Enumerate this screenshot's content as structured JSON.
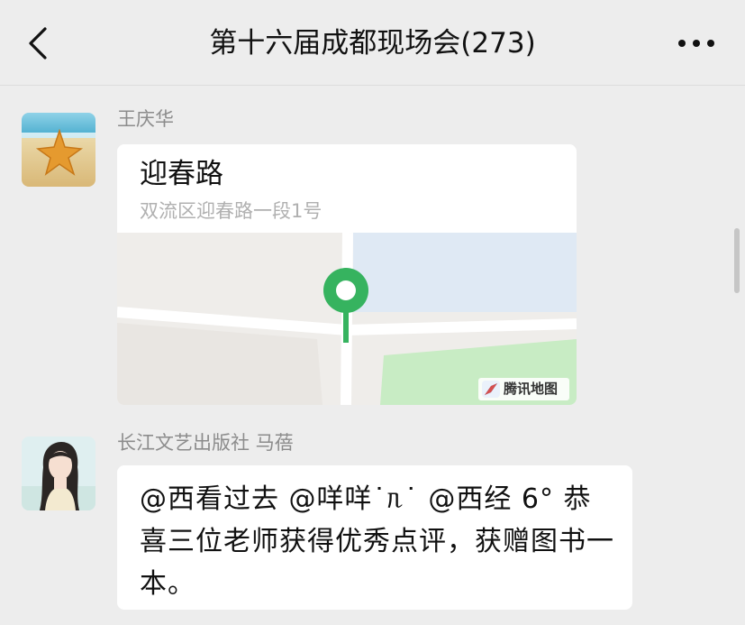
{
  "header": {
    "title": "第十六届成都现场会(273)",
    "back_icon": "chevron-left-icon",
    "more_icon": "more-dots-icon"
  },
  "messages": [
    {
      "sender": "王庆华",
      "avatar": "starfish-beach-avatar",
      "type": "location",
      "location": {
        "name": "迎春路",
        "address": "双流区迎春路一段1号",
        "map_provider": "腾讯地图"
      }
    },
    {
      "sender": "长江文艺出版社 马蓓",
      "avatar": "illustrated-girl-avatar",
      "type": "text",
      "text": "@西看过去 @咩咩˙ᥰ˙ @西经 6° 恭喜三位老师获得优秀点评，获赠图书一本。"
    }
  ],
  "colors": {
    "background": "#ededed",
    "bubble": "#ffffff",
    "pin": "#36b35f",
    "map_green": "#c8ecc4",
    "map_water": "#dfe9f4"
  }
}
